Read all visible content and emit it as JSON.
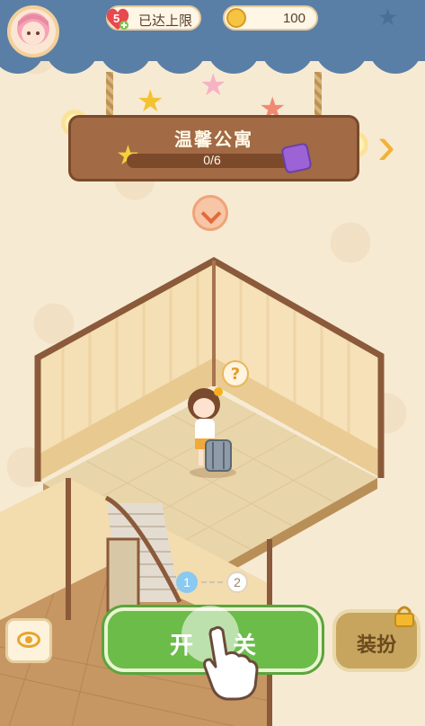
{
  "hud": {
    "energy_count": "5",
    "energy_text": "已达上限",
    "coins": "100"
  },
  "building": {
    "name": "温馨公寓",
    "progress_text": "0/6",
    "progress_fraction": 0.0
  },
  "tutorial": {
    "step1": "1",
    "step2": "2"
  },
  "actions": {
    "main_button": "开关",
    "dress_button": "装扮"
  },
  "icons": [
    "avatar-icon",
    "heart-icon",
    "coin-icon",
    "star-icon",
    "gift-icon",
    "next-arrow-icon",
    "down-arrow-icon",
    "question-icon",
    "eye-icon",
    "lock-icon",
    "pointer-hand-icon"
  ],
  "colors": {
    "topbar": "#5a7fa6",
    "sign": "#a26a45",
    "primary_button": "#6cbc4a",
    "dress_button": "#c7a55e"
  }
}
